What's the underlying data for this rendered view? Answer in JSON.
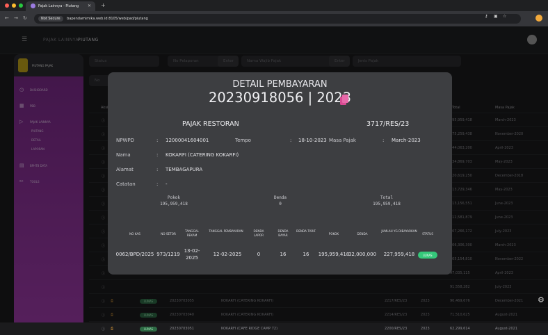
{
  "browser": {
    "tab_title": "Pajak Lainnya - Piutang",
    "secure_label": "Not Secure",
    "url": "bapendamimika.web.id:8105/web/pad/piutang"
  },
  "header": {
    "crumb_parent": "PAJAK LAINNYA",
    "crumb_current": "PIUTANG"
  },
  "sidebar": {
    "title": "PIUTANG PAJAK",
    "items": [
      {
        "label": "DASHBOARD",
        "icon": "dashboard-icon"
      },
      {
        "label": "PBB",
        "icon": "building-icon"
      },
      {
        "label": "PAJAK LAINNYA",
        "icon": "tag-icon"
      },
      {
        "label": "PIUTANG",
        "icon": ""
      },
      {
        "label": "DETAIL",
        "icon": ""
      },
      {
        "label": "LAPORAN",
        "icon": ""
      },
      {
        "label": "BPHTB DATA",
        "icon": "document-icon"
      },
      {
        "label": "TOOLS",
        "icon": "tools-icon"
      }
    ]
  },
  "filters": {
    "status": "Status",
    "pelaporan": "No Pelaporan",
    "enter1": "Enter",
    "wajib": "Nama Wajib Pajak",
    "enter2": "Enter",
    "jenis": "Jenis Pajak",
    "no": "No"
  },
  "table": {
    "col_aksi": "Aksi",
    "col_total": "Total",
    "col_masa": "Masa Pajak",
    "rows": [
      {
        "total": "195,959,418",
        "masa": "March-2023"
      },
      {
        "total": "175,259,438",
        "masa": "November-2020"
      },
      {
        "total": "144,063,200",
        "masa": "April-2023"
      },
      {
        "total": "134,869,703",
        "masa": "May-2023"
      },
      {
        "total": "120,619,250",
        "masa": "December-2018"
      },
      {
        "total": "113,729,346",
        "masa": "May-2023"
      },
      {
        "total": "113,156,551",
        "masa": "June-2023"
      },
      {
        "total": "112,581,879",
        "masa": "June-2023"
      },
      {
        "total": "107,266,172",
        "masa": "July-2023"
      },
      {
        "total": "106,306,300",
        "masa": "March-2023"
      },
      {
        "total": "105,154,810",
        "masa": "November-2022"
      },
      {
        "total": "97,035,115",
        "masa": "April-2023"
      },
      {
        "total": "91,558,282",
        "masa": "July-2023"
      }
    ],
    "full_rows": [
      {
        "status": "LUNAS",
        "no": "20230703055",
        "nama": "KOKARFI (CATERING KOKARFI)",
        "kode": "2217/RES/23",
        "tahun": "2023",
        "total": "90,469,676",
        "masa": "December-2021"
      },
      {
        "status": "LUNAS",
        "no": "20230703040",
        "nama": "KOKARFI (CATERING KOKARFI)",
        "kode": "2214/RES/23",
        "tahun": "2023",
        "total": "71,510,625",
        "masa": "August-2021"
      },
      {
        "status": "LUNAS",
        "no": "20230703051",
        "nama": "KOKARFI (CAFE RIDGE CAMP 72)",
        "kode": "2200/RES/23",
        "tahun": "2023",
        "total": "62,299,614",
        "masa": "August-2021"
      }
    ]
  },
  "modal": {
    "subtitle": "DETAIL PEMBAYARAN",
    "title": "20230918056 | 2023",
    "jenis": "PAJAK RESTORAN",
    "kode": "3717/RES/23",
    "npwpd_label": "NPWPD",
    "npwpd": "12000041604001",
    "tempo_label": "Tempo",
    "tempo": "18-10-2023",
    "masa_label": "Masa Pajak",
    "masa": "March-2023",
    "nama_label": "Nama",
    "nama": "KOKARFI (CATERING KOKARFI)",
    "alamat_label": "Alamat",
    "alamat": "TEMBAGAPURA",
    "catatan_label": "Catatan",
    "catatan": "-",
    "colon": ":",
    "pokok_label": "Pokok",
    "pokok": "195,959,418",
    "denda_label": "Denda",
    "denda": "0",
    "total_label": "Total",
    "total": "195,959,418",
    "cols": [
      "NO KAS",
      "NO SETOR",
      "TANGGAL REKAM",
      "TANGGAL PEMBAYARAN",
      "DENDA LAPOR",
      "DENDA BAYAR",
      "DENDA TARIF",
      "POKOK",
      "DENDA",
      "JUMLAH YG DIBAYARKAN",
      "STATUS"
    ],
    "row": {
      "no_kas": "0062/BPD/2025",
      "no_setor": "973/1219",
      "tgl_rekam": "13-02-2025",
      "tgl_bayar": "12-02-2025",
      "denda_lapor": "0",
      "denda_bayar": "16",
      "denda_tarif": "16",
      "pokok": "195,959,418",
      "denda": "32,000,000",
      "jumlah": "227,959,418",
      "status": "LUNAS"
    }
  }
}
